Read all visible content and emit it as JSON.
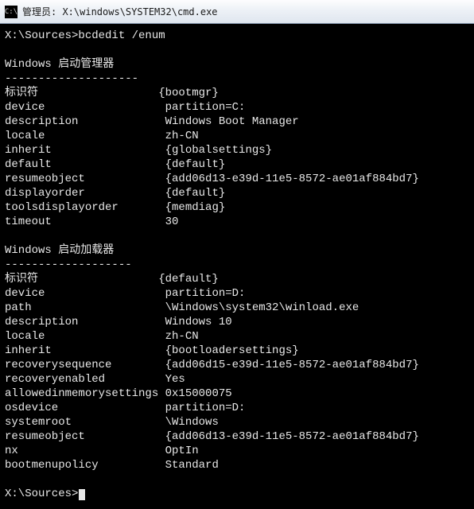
{
  "titlebar": {
    "icon_label": "C:\\",
    "title": "管理员: X:\\windows\\SYSTEM32\\cmd.exe"
  },
  "terminal": {
    "prompt1": "X:\\Sources>",
    "command1": "bcdedit /enum",
    "section1": {
      "header": "Windows 启动管理器",
      "divider": "--------------------",
      "rows": [
        {
          "k": "标识符",
          "v": "{bootmgr}"
        },
        {
          "k": "device",
          "v": "partition=C:"
        },
        {
          "k": "description",
          "v": "Windows Boot Manager"
        },
        {
          "k": "locale",
          "v": "zh-CN"
        },
        {
          "k": "inherit",
          "v": "{globalsettings}"
        },
        {
          "k": "default",
          "v": "{default}"
        },
        {
          "k": "resumeobject",
          "v": "{add06d13-e39d-11e5-8572-ae01af884bd7}"
        },
        {
          "k": "displayorder",
          "v": "{default}"
        },
        {
          "k": "toolsdisplayorder",
          "v": "{memdiag}"
        },
        {
          "k": "timeout",
          "v": "30"
        }
      ]
    },
    "section2": {
      "header": "Windows 启动加载器",
      "divider": "-------------------",
      "rows": [
        {
          "k": "标识符",
          "v": "{default}"
        },
        {
          "k": "device",
          "v": "partition=D:"
        },
        {
          "k": "path",
          "v": "\\Windows\\system32\\winload.exe"
        },
        {
          "k": "description",
          "v": "Windows 10"
        },
        {
          "k": "locale",
          "v": "zh-CN"
        },
        {
          "k": "inherit",
          "v": "{bootloadersettings}"
        },
        {
          "k": "recoverysequence",
          "v": "{add06d15-e39d-11e5-8572-ae01af884bd7}"
        },
        {
          "k": "recoveryenabled",
          "v": "Yes"
        },
        {
          "k": "allowedinmemorysettings",
          "v": "0x15000075"
        },
        {
          "k": "osdevice",
          "v": "partition=D:"
        },
        {
          "k": "systemroot",
          "v": "\\Windows"
        },
        {
          "k": "resumeobject",
          "v": "{add06d13-e39d-11e5-8572-ae01af884bd7}"
        },
        {
          "k": "nx",
          "v": "OptIn"
        },
        {
          "k": "bootmenupolicy",
          "v": "Standard"
        }
      ]
    },
    "prompt2": "X:\\Sources>"
  }
}
